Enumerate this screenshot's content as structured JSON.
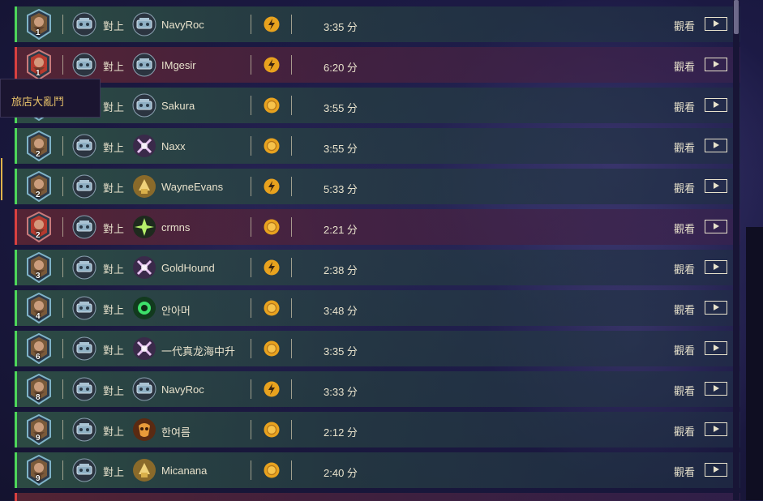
{
  "tooltip": {
    "label": "旅店大亂鬥"
  },
  "vs_label": "對上",
  "watch_label": "觀看",
  "matches": [
    {
      "level": "1",
      "result": "win",
      "opponent": "NavyRoc",
      "opp_icon": "mech-hero-power-icon",
      "coin": "bolt",
      "duration": "3:35 分"
    },
    {
      "level": "1",
      "result": "loss",
      "opponent": "IMgesir",
      "opp_icon": "mech-hero-power-icon",
      "coin": "bolt",
      "duration": "6:20 分"
    },
    {
      "level": "",
      "result": "win",
      "opponent": "Sakura",
      "opp_icon": "mech-hero-power-icon",
      "coin": "coin",
      "duration": "3:55 分"
    },
    {
      "level": "2",
      "result": "win",
      "opponent": "Naxx",
      "opp_icon": "arcane-hero-power-icon",
      "coin": "coin",
      "duration": "3:55 分"
    },
    {
      "level": "2",
      "result": "win",
      "opponent": "WayneEvans",
      "opp_icon": "gold-hero-power-icon",
      "coin": "bolt",
      "duration": "5:33 分"
    },
    {
      "level": "2",
      "result": "loss",
      "opponent": "crmns",
      "opp_icon": "nature-hero-power-icon",
      "coin": "coin",
      "duration": "2:21 分"
    },
    {
      "level": "3",
      "result": "win",
      "opponent": "GoldHound",
      "opp_icon": "arcane-hero-power-icon",
      "coin": "bolt",
      "duration": "2:38 分"
    },
    {
      "level": "4",
      "result": "win",
      "opponent": "안아머",
      "opp_icon": "fel-hero-power-icon",
      "coin": "coin",
      "duration": "3:48 分"
    },
    {
      "level": "6",
      "result": "win",
      "opponent": "一代真龙海中升",
      "opp_icon": "arcane-hero-power-icon",
      "coin": "coin",
      "duration": "3:35 分"
    },
    {
      "level": "8",
      "result": "win",
      "opponent": "NavyRoc",
      "opp_icon": "mech-hero-power-icon",
      "coin": "bolt",
      "duration": "3:33 分"
    },
    {
      "level": "9",
      "result": "win",
      "opponent": "한여름",
      "opp_icon": "tribal-hero-power-icon",
      "coin": "coin",
      "duration": "2:12 分"
    },
    {
      "level": "9",
      "result": "win",
      "opponent": "Micanana",
      "opp_icon": "gold-hero-power-icon",
      "coin": "coin",
      "duration": "2:40 分"
    }
  ],
  "colors": {
    "win": "#4dd65a",
    "loss": "#d84040",
    "coin": "#e8a21e",
    "text": "#e8e2cc",
    "tooltip_text": "#e9c36a"
  }
}
